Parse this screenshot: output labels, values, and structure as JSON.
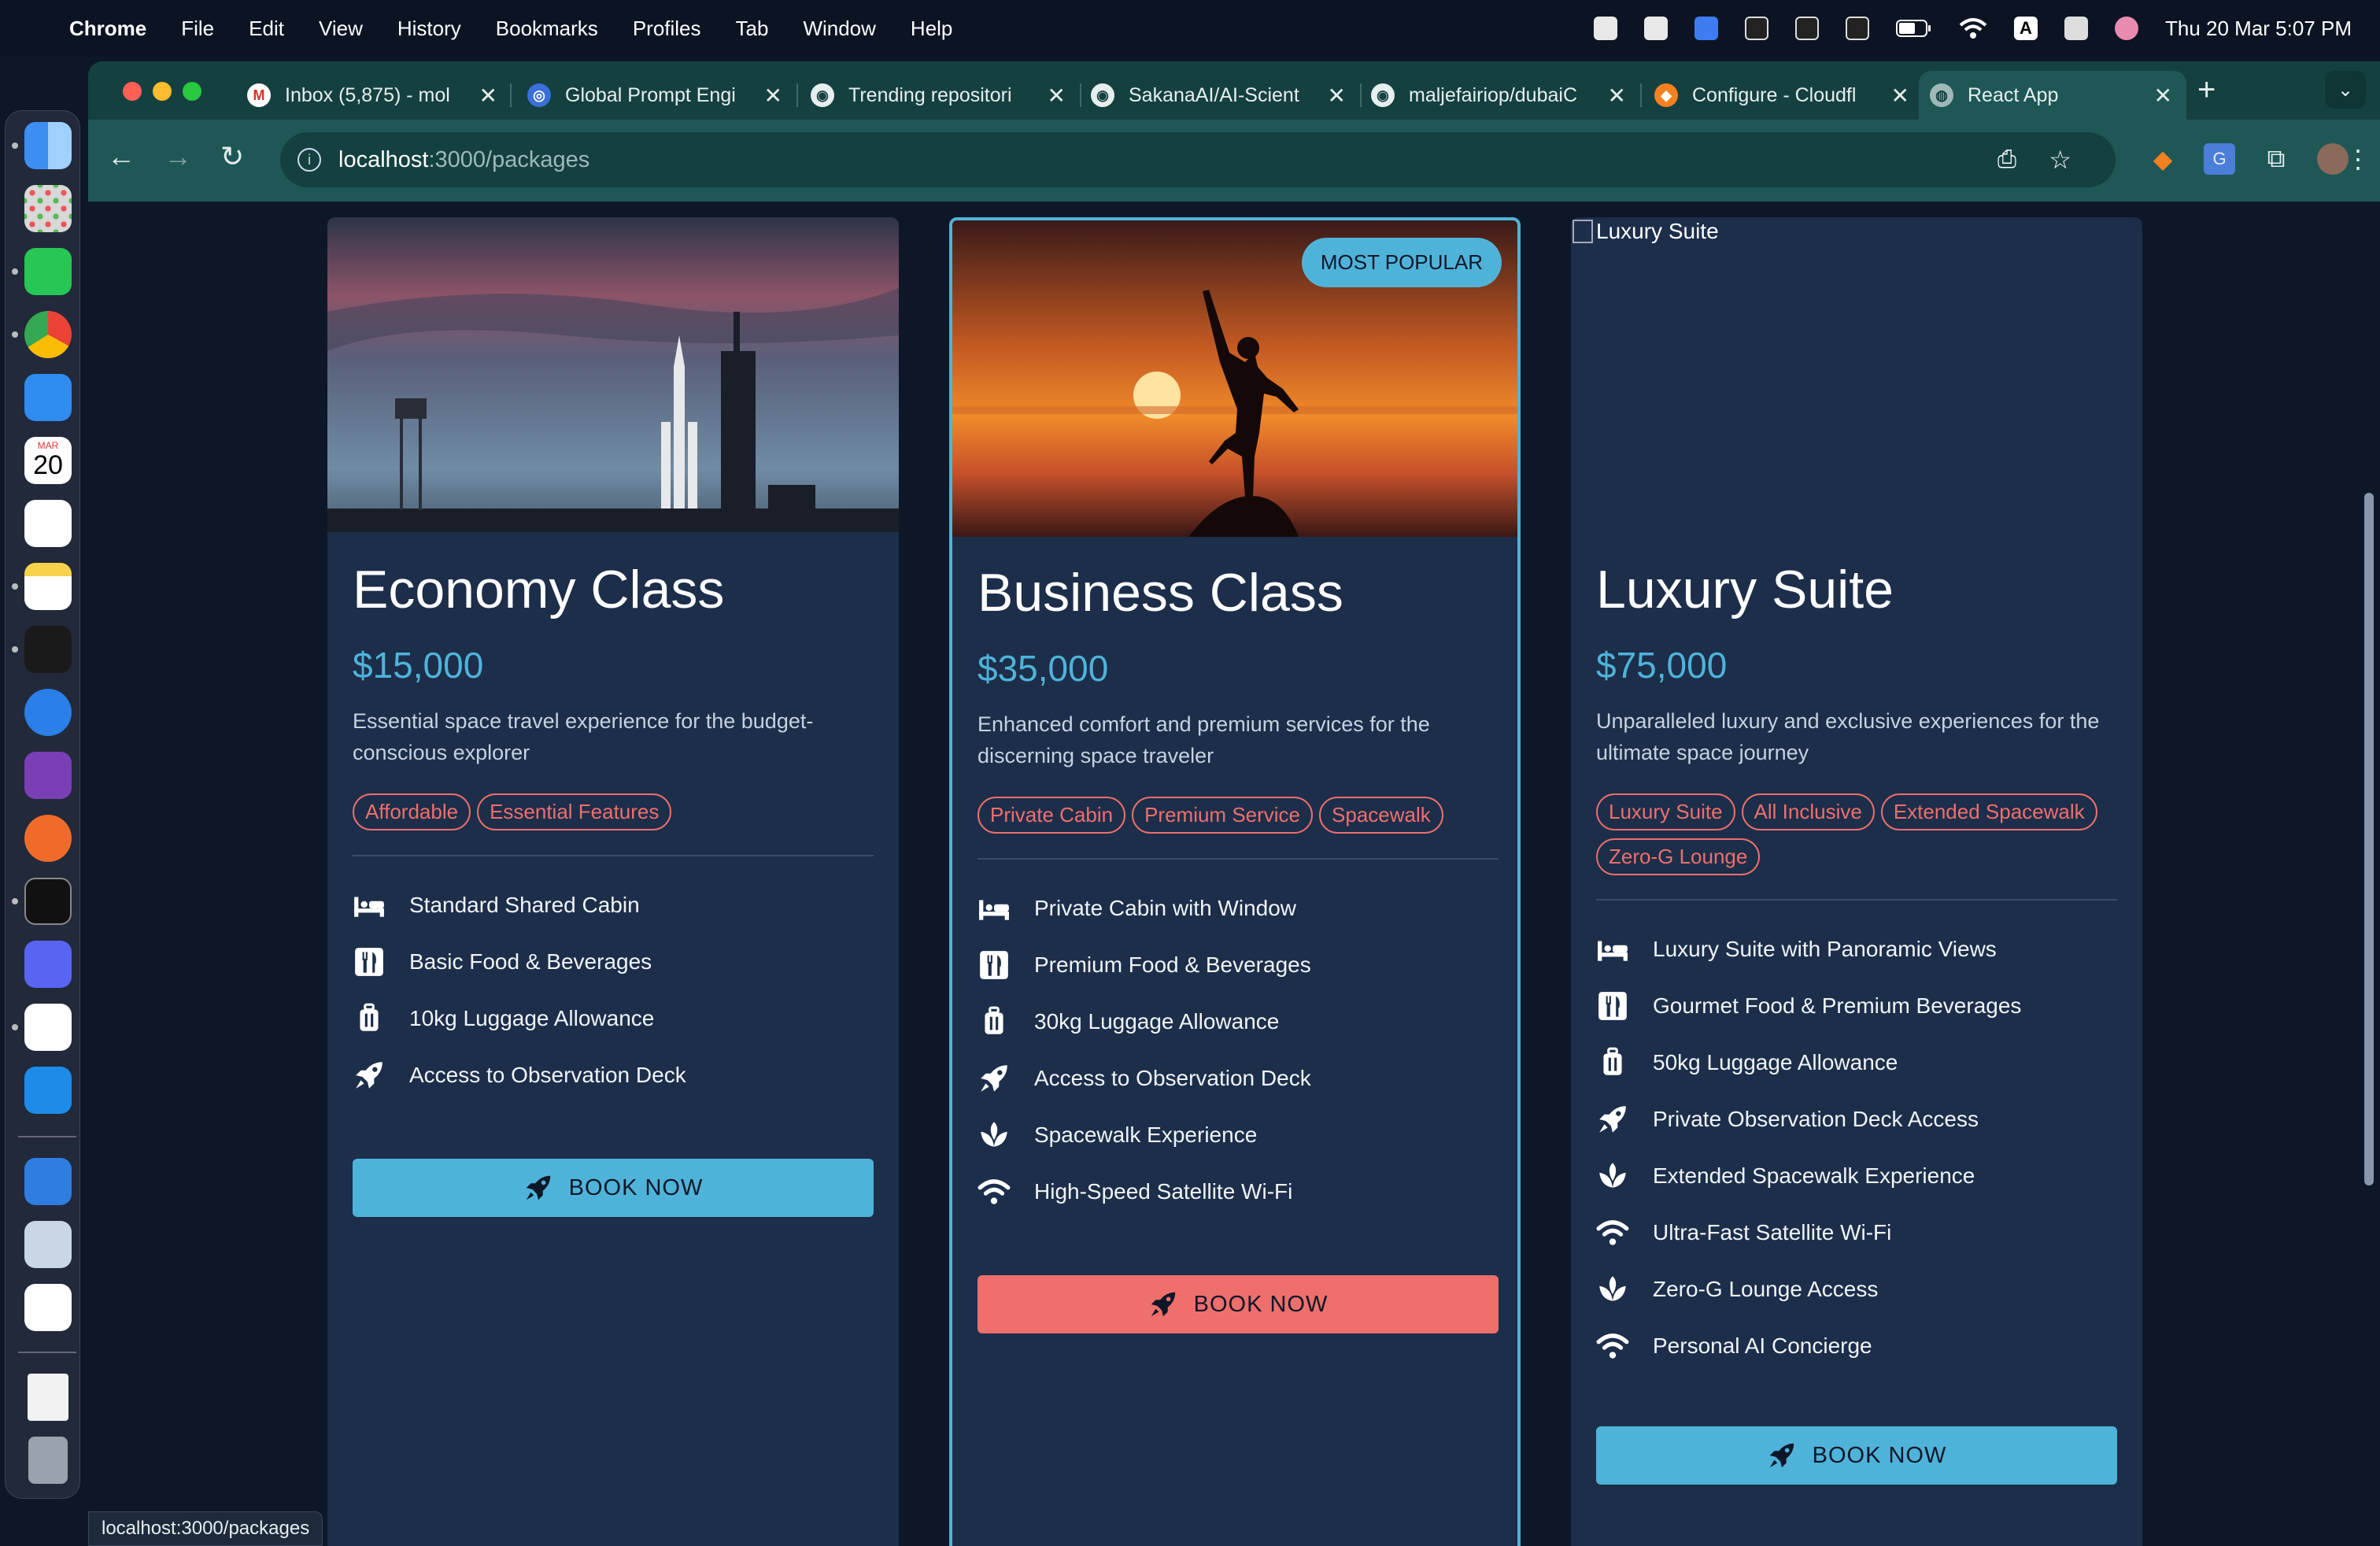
{
  "menubar": {
    "app": "Chrome",
    "items": [
      "File",
      "Edit",
      "View",
      "History",
      "Bookmarks",
      "Profiles",
      "Tab",
      "Window",
      "Help"
    ],
    "clock": "Thu 20 Mar  5:07 PM"
  },
  "dock": {
    "icons": [
      "finder-icon",
      "launchpad-icon",
      "whatsapp-icon",
      "chrome-icon",
      "mail-icon",
      "calendar-icon",
      "reminders-icon",
      "notes-icon",
      "cursor-icon",
      "safari-icon",
      "github-desktop-icon",
      "postman-icon",
      "terminal-icon",
      "discord-icon",
      "chatgpt-icon",
      "docker-icon",
      "keynote-icon",
      "preview-icon",
      "ollama-icon",
      "document-icon",
      "trash-icon"
    ],
    "calendar": {
      "month": "MAR",
      "day": "20"
    }
  },
  "tabs": [
    {
      "title": "Inbox (5,875) - mol",
      "icon": "M"
    },
    {
      "title": "Global Prompt Engi",
      "icon": "◎"
    },
    {
      "title": "Trending repositori",
      "icon": "◉"
    },
    {
      "title": "SakanaAI/AI-Scient",
      "icon": "◉"
    },
    {
      "title": "maljefairiop/dubaiC",
      "icon": "◉"
    },
    {
      "title": "Configure - Cloudfl",
      "icon": "◆"
    },
    {
      "title": "React App",
      "icon": "◍"
    }
  ],
  "address": {
    "host": "localhost",
    "path": ":3000/packages"
  },
  "status_url": "localhost:3000/packages",
  "colors": {
    "accent": "#4fb3d9",
    "coral": "#ef6f6c",
    "card": "#1c2e4a",
    "page": "#0d1728"
  },
  "cards": [
    {
      "title": "Economy Class",
      "price": "$15,000",
      "description": "Essential space travel experience for the budget-conscious explorer",
      "tags": [
        "Affordable",
        "Essential Features"
      ],
      "features": [
        {
          "icon": "bed-icon",
          "label": "Standard Shared Cabin"
        },
        {
          "icon": "utensils-icon",
          "label": "Basic Food & Beverages"
        },
        {
          "icon": "luggage-icon",
          "label": "10kg Luggage Allowance"
        },
        {
          "icon": "rocket-icon",
          "label": "Access to Observation Deck"
        }
      ],
      "button": "BOOK NOW",
      "image": "rocket-launchpad"
    },
    {
      "title": "Business Class",
      "badge": "MOST POPULAR",
      "price": "$35,000",
      "description": "Enhanced comfort and premium services for the discerning space traveler",
      "tags": [
        "Private Cabin",
        "Premium Service",
        "Spacewalk"
      ],
      "features": [
        {
          "icon": "bed-icon",
          "label": "Private Cabin with Window"
        },
        {
          "icon": "utensils-icon",
          "label": "Premium Food & Beverages"
        },
        {
          "icon": "luggage-icon",
          "label": "30kg Luggage Allowance"
        },
        {
          "icon": "rocket-icon",
          "label": "Access to Observation Deck"
        },
        {
          "icon": "spa-icon",
          "label": "Spacewalk Experience"
        },
        {
          "icon": "wifi-icon",
          "label": "High-Speed Satellite Wi-Fi"
        }
      ],
      "button": "BOOK NOW",
      "image": "sunset-silhouette"
    },
    {
      "title": "Luxury Suite",
      "image_alt": "Luxury Suite",
      "price": "$75,000",
      "description": "Unparalleled luxury and exclusive experiences for the ultimate space journey",
      "tags": [
        "Luxury Suite",
        "All Inclusive",
        "Extended Spacewalk",
        "Zero-G Lounge"
      ],
      "features": [
        {
          "icon": "bed-icon",
          "label": "Luxury Suite with Panoramic Views"
        },
        {
          "icon": "utensils-icon",
          "label": "Gourmet Food & Premium Beverages"
        },
        {
          "icon": "luggage-icon",
          "label": "50kg Luggage Allowance"
        },
        {
          "icon": "rocket-icon",
          "label": "Private Observation Deck Access"
        },
        {
          "icon": "spa-icon",
          "label": "Extended Spacewalk Experience"
        },
        {
          "icon": "wifi-icon",
          "label": "Ultra-Fast Satellite Wi-Fi"
        },
        {
          "icon": "spa-icon",
          "label": "Zero-G Lounge Access"
        },
        {
          "icon": "wifi-icon",
          "label": "Personal AI Concierge"
        }
      ],
      "button": "BOOK NOW"
    }
  ]
}
